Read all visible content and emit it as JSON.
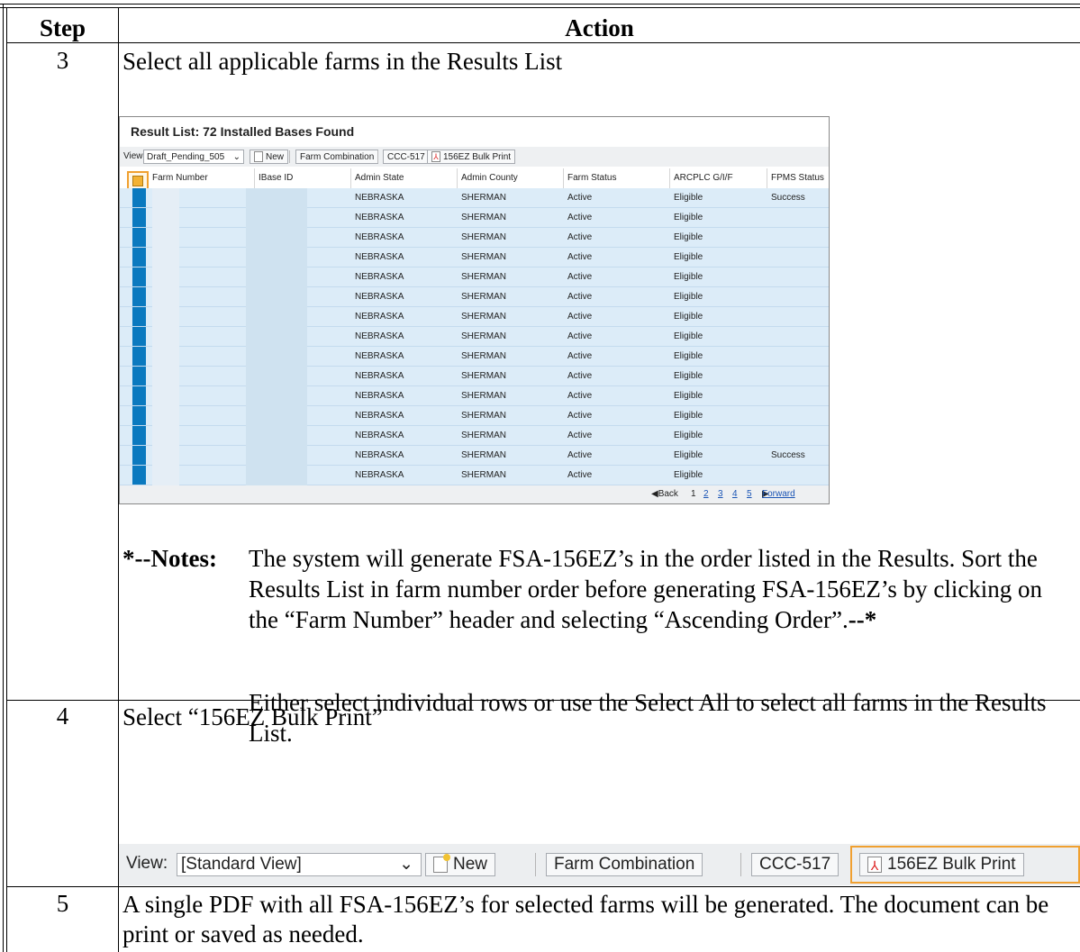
{
  "table_header": {
    "step": "Step",
    "action": "Action"
  },
  "step3": {
    "number": "3",
    "text": "Select all applicable farms in the Results List",
    "screenshot": {
      "title": "Result List: 72 Installed Bases Found",
      "view_label": "View:",
      "view_value": "Draft_Pending_505",
      "new_label": "New",
      "farm_combination_label": "Farm Combination",
      "ccc_label": "CCC-517",
      "bulk_print_label": "156EZ Bulk Print",
      "columns": [
        "Farm Number",
        "IBase ID",
        "Admin State",
        "Admin County",
        "Farm Status",
        "ARCPLC G/I/F",
        "FPMS Status"
      ],
      "rows": [
        {
          "state": "NEBRASKA",
          "county": "SHERMAN",
          "status": "Active",
          "arc": "Eligible",
          "fpms": "Success"
        },
        {
          "state": "NEBRASKA",
          "county": "SHERMAN",
          "status": "Active",
          "arc": "Eligible",
          "fpms": ""
        },
        {
          "state": "NEBRASKA",
          "county": "SHERMAN",
          "status": "Active",
          "arc": "Eligible",
          "fpms": ""
        },
        {
          "state": "NEBRASKA",
          "county": "SHERMAN",
          "status": "Active",
          "arc": "Eligible",
          "fpms": ""
        },
        {
          "state": "NEBRASKA",
          "county": "SHERMAN",
          "status": "Active",
          "arc": "Eligible",
          "fpms": ""
        },
        {
          "state": "NEBRASKA",
          "county": "SHERMAN",
          "status": "Active",
          "arc": "Eligible",
          "fpms": ""
        },
        {
          "state": "NEBRASKA",
          "county": "SHERMAN",
          "status": "Active",
          "arc": "Eligible",
          "fpms": ""
        },
        {
          "state": "NEBRASKA",
          "county": "SHERMAN",
          "status": "Active",
          "arc": "Eligible",
          "fpms": ""
        },
        {
          "state": "NEBRASKA",
          "county": "SHERMAN",
          "status": "Active",
          "arc": "Eligible",
          "fpms": ""
        },
        {
          "state": "NEBRASKA",
          "county": "SHERMAN",
          "status": "Active",
          "arc": "Eligible",
          "fpms": ""
        },
        {
          "state": "NEBRASKA",
          "county": "SHERMAN",
          "status": "Active",
          "arc": "Eligible",
          "fpms": ""
        },
        {
          "state": "NEBRASKA",
          "county": "SHERMAN",
          "status": "Active",
          "arc": "Eligible",
          "fpms": ""
        },
        {
          "state": "NEBRASKA",
          "county": "SHERMAN",
          "status": "Active",
          "arc": "Eligible",
          "fpms": ""
        },
        {
          "state": "NEBRASKA",
          "county": "SHERMAN",
          "status": "Active",
          "arc": "Eligible",
          "fpms": "Success"
        },
        {
          "state": "NEBRASKA",
          "county": "SHERMAN",
          "status": "Active",
          "arc": "Eligible",
          "fpms": ""
        }
      ],
      "pager": {
        "back": "Back",
        "pages": [
          "1",
          "2",
          "3",
          "4",
          "5"
        ],
        "forward": "Forward"
      }
    },
    "notes_label": "*--Notes:",
    "notes_text": "The system will generate FSA-156EZ’s in the order listed in the Results.  Sort the Results List in farm number order before generating FSA-156EZ’s by clicking on the “Farm Number” header and selecting “Ascending Order”.",
    "notes_end": "--*",
    "notes_text2": "Either select individual rows or use the Select All to select all farms in the Results List."
  },
  "step4": {
    "number": "4",
    "text": "Select “156EZ Bulk Print”",
    "toolbar": {
      "view_label": "View:",
      "view_value": "[Standard View]",
      "new_label": "New",
      "farm_combination_label": "Farm Combination",
      "ccc_label": "CCC-517",
      "bulk_print_label": "156EZ Bulk Print"
    }
  },
  "step5": {
    "number": "5",
    "text": "A single PDF with all FSA-156EZ’s for selected farms will be generated.  The document can be print or saved as needed."
  },
  "colors": {
    "selected_row_blue": "#0a79bf",
    "row_bg": "#dcecf8",
    "highlight_orange": "#f0a030"
  }
}
